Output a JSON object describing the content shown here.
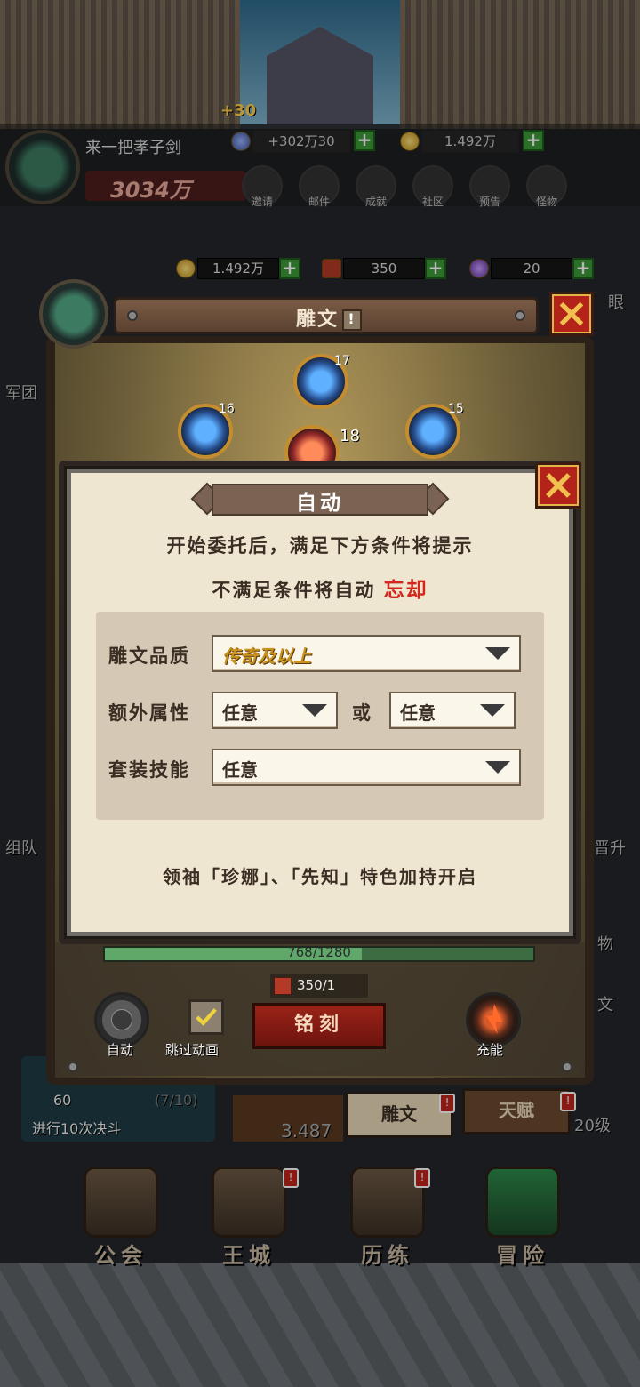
{
  "floating_reward": "+30",
  "player": {
    "name": "来一把孝子剑",
    "power": "3034万",
    "gem_top": "+302万30",
    "gold_top": "1.492万"
  },
  "top_icons": [
    {
      "icon": "invite-icon",
      "label": "邀请"
    },
    {
      "icon": "mail-icon",
      "label": "邮件"
    },
    {
      "icon": "achievement-icon",
      "label": "成就"
    },
    {
      "icon": "community-icon",
      "label": "社区"
    },
    {
      "icon": "notice-icon",
      "label": "预告"
    },
    {
      "icon": "monster-icon",
      "label": "怪物"
    }
  ],
  "resources": {
    "gold": "1.492万",
    "book": "350",
    "crystal": "20"
  },
  "side_labels": {
    "left_1": "军团",
    "left_2": "组队",
    "right_1": "眼",
    "right_2": "晋升",
    "right_3": "物",
    "right_4": "文"
  },
  "rune_panel": {
    "title": "雕文",
    "title_badge": "!",
    "gems": [
      {
        "level": "17"
      },
      {
        "level": "16"
      },
      {
        "level": "15"
      },
      {
        "level": "18"
      }
    ],
    "progress": "768/1280",
    "progress_fraction": 0.6,
    "cost": "350/1",
    "auto_label": "自动",
    "skip_label": "跳过动画",
    "engrave_label": "铭刻",
    "charge_label": "充能"
  },
  "quest": {
    "value": "60",
    "counter": "(7/10)",
    "text": "进行10次决斗",
    "amount": "3.487"
  },
  "tabs": {
    "rune": "雕文",
    "talent": "天赋",
    "level": "20级"
  },
  "nav": [
    {
      "label": "公会",
      "icon": "guild-icon"
    },
    {
      "label": "王城",
      "icon": "castle-icon"
    },
    {
      "label": "历练",
      "icon": "training-icon"
    },
    {
      "label": "冒险",
      "icon": "adventure-icon"
    }
  ],
  "dialog": {
    "title": "自动",
    "line1": "开始委托后，满足下方条件将提示",
    "line2_prefix": "不满足条件将自动",
    "line2_action": "忘却",
    "conditions": {
      "quality_label": "雕文品质",
      "quality_value": "传奇及以上",
      "extra_label": "额外属性",
      "extra_value_1": "任意",
      "or_label": "或",
      "extra_value_2": "任意",
      "set_label": "套装技能",
      "set_value": "任意"
    },
    "footer": "领袖「珍娜」、「先知」特色加持开启"
  },
  "colors": {
    "dialog_bg": "#efe6d1",
    "accent_red": "#d3261c",
    "legendary_gold": "#c8921d",
    "plus_green": "#3c9a39"
  }
}
